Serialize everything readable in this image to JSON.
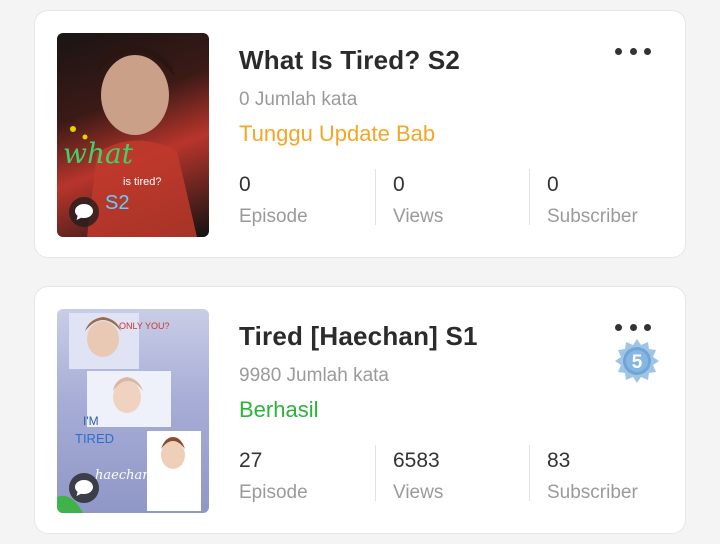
{
  "stories": [
    {
      "title": "What Is Tired? S2",
      "word_count": "0 Jumlah kata",
      "status": "Tunggu Update Bab",
      "status_color": "#f5a623",
      "stats": [
        {
          "value": "0",
          "label": "Episode"
        },
        {
          "value": "0",
          "label": "Views"
        },
        {
          "value": "0",
          "label": "Subscriber"
        }
      ],
      "cover_text": [
        "what",
        "is tired?",
        "S2"
      ]
    },
    {
      "title": "Tired [Haechan] S1",
      "word_count": "9980 Jumlah kata",
      "status": "Berhasil",
      "status_color": "#2bb33a",
      "badge": "5",
      "stats": [
        {
          "value": "27",
          "label": "Episode"
        },
        {
          "value": "6583",
          "label": "Views"
        },
        {
          "value": "83",
          "label": "Subscriber"
        }
      ],
      "cover_text": [
        "ONLY YOU?",
        "I'M",
        "TIRED",
        "haechan"
      ]
    }
  ],
  "icons": {
    "more": "more-options-icon",
    "comment": "comment-icon",
    "badge": "level-badge-icon"
  }
}
